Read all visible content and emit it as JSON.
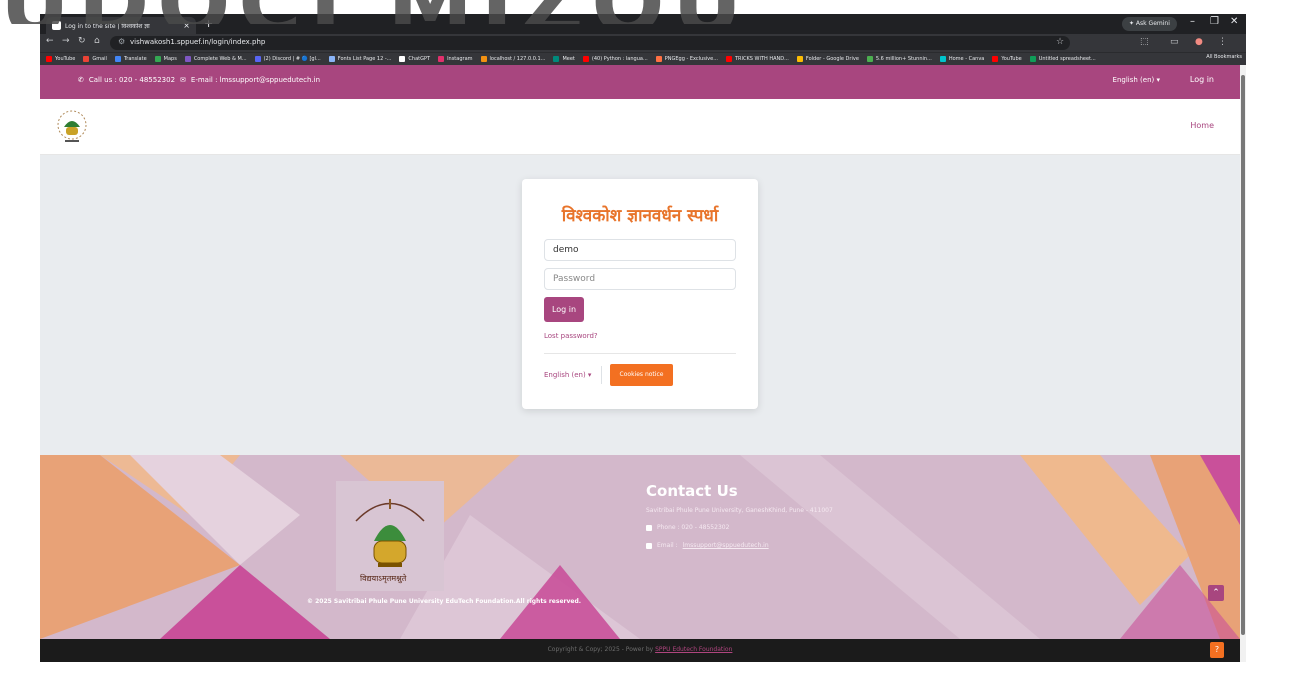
{
  "browser": {
    "tab_title": "Log in to the site | विश्वकोश ज्ञा",
    "tab_close": "×",
    "new_tab": "+",
    "ask_gemini": "✦ Ask Gemini",
    "url": "vishwakosh1.sppuef.in/login/index.php",
    "bookmarks": [
      "YouTube",
      "Gmail",
      "Translate",
      "Maps",
      "Complete Web & M...",
      "(2) Discord | # 🔵 [gl...",
      "Fonts List Page 12 -...",
      "ChatGPT",
      "Instagram",
      "localhost / 127.0.0.1...",
      "Meet",
      "(40) Python : langua...",
      "PNGEgg - Exclusive...",
      "TRICKS WITH HAND...",
      "Folder - Google Drive",
      "5.6 million+ Stunnin...",
      "Home - Canva",
      "YouTube",
      "Untitled spreadsheet..."
    ],
    "all_bookmarks": "All Bookmarks"
  },
  "topbar": {
    "call_text": "Call us : 020 - 48552302",
    "email_text": "E-mail : lmssupport@sppuedutech.in",
    "language": "English (en) ▾",
    "login": "Log in"
  },
  "header": {
    "home": "Home"
  },
  "login": {
    "title": "विश्वकोश ज्ञानवर्धन स्पर्धा",
    "username_value": "demo",
    "password_placeholder": "Password",
    "login_button": "Log in",
    "lost_password": "Lost password?",
    "language": "English (en) ▾",
    "cookies": "Cookies notice"
  },
  "footer": {
    "logo_motto": "विद्ययाऽमृतमश्नुते",
    "copyright": "© 2025 Savitribai Phule Pune University EduTech Foundation.All rights reserved.",
    "contact_title": "Contact Us",
    "address": "Savitribai Phule Pune University, GaneshKhind, Pune - 411007",
    "phone": "Phone : 020 - 48552302",
    "email_label": "Email :",
    "email": "lmssupport@sppuedutech.in"
  },
  "bottombar": {
    "text": "Copyright & Copy; 2025 - Power by ",
    "link": "SPPU Edutech Foundation",
    "help": "?"
  },
  "watermark": "UDOCI MIZOU",
  "colors": {
    "brand": "#a8467f",
    "accent": "#f37021",
    "title": "#e8742b"
  }
}
